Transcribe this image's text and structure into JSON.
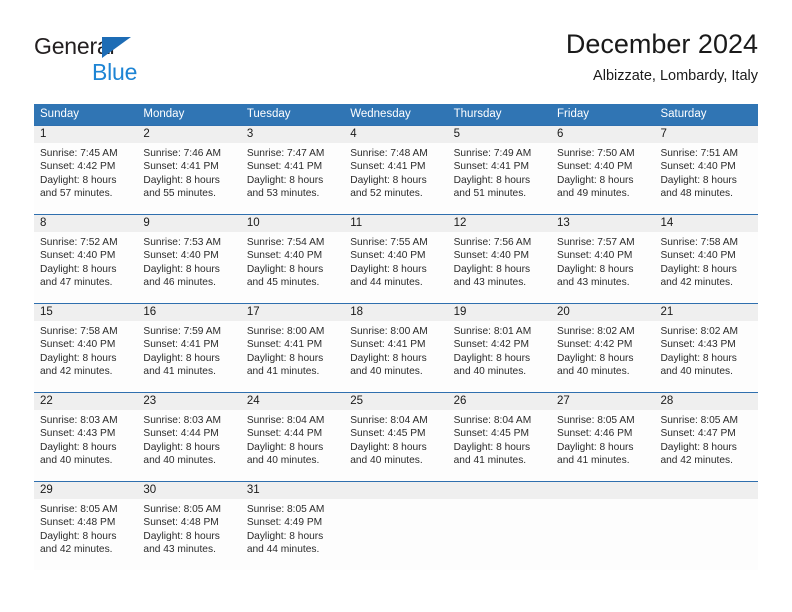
{
  "brand": {
    "name_dark": "General",
    "name_blue": "Blue",
    "accent_blue": "#1d84d4",
    "triangle_blue": "#1d6cb5"
  },
  "header": {
    "month_title": "December 2024",
    "location": "Albizzate, Lombardy, Italy"
  },
  "calendar": {
    "header_bg": "#3075b4",
    "numbar_bg": "#efefef",
    "weekday_headers": [
      "Sunday",
      "Monday",
      "Tuesday",
      "Wednesday",
      "Thursday",
      "Friday",
      "Saturday"
    ],
    "weeks": [
      [
        {
          "day": "1",
          "sunrise": "Sunrise: 7:45 AM",
          "sunset": "Sunset: 4:42 PM",
          "daylight1": "Daylight: 8 hours",
          "daylight2": "and 57 minutes."
        },
        {
          "day": "2",
          "sunrise": "Sunrise: 7:46 AM",
          "sunset": "Sunset: 4:41 PM",
          "daylight1": "Daylight: 8 hours",
          "daylight2": "and 55 minutes."
        },
        {
          "day": "3",
          "sunrise": "Sunrise: 7:47 AM",
          "sunset": "Sunset: 4:41 PM",
          "daylight1": "Daylight: 8 hours",
          "daylight2": "and 53 minutes."
        },
        {
          "day": "4",
          "sunrise": "Sunrise: 7:48 AM",
          "sunset": "Sunset: 4:41 PM",
          "daylight1": "Daylight: 8 hours",
          "daylight2": "and 52 minutes."
        },
        {
          "day": "5",
          "sunrise": "Sunrise: 7:49 AM",
          "sunset": "Sunset: 4:41 PM",
          "daylight1": "Daylight: 8 hours",
          "daylight2": "and 51 minutes."
        },
        {
          "day": "6",
          "sunrise": "Sunrise: 7:50 AM",
          "sunset": "Sunset: 4:40 PM",
          "daylight1": "Daylight: 8 hours",
          "daylight2": "and 49 minutes."
        },
        {
          "day": "7",
          "sunrise": "Sunrise: 7:51 AM",
          "sunset": "Sunset: 4:40 PM",
          "daylight1": "Daylight: 8 hours",
          "daylight2": "and 48 minutes."
        }
      ],
      [
        {
          "day": "8",
          "sunrise": "Sunrise: 7:52 AM",
          "sunset": "Sunset: 4:40 PM",
          "daylight1": "Daylight: 8 hours",
          "daylight2": "and 47 minutes."
        },
        {
          "day": "9",
          "sunrise": "Sunrise: 7:53 AM",
          "sunset": "Sunset: 4:40 PM",
          "daylight1": "Daylight: 8 hours",
          "daylight2": "and 46 minutes."
        },
        {
          "day": "10",
          "sunrise": "Sunrise: 7:54 AM",
          "sunset": "Sunset: 4:40 PM",
          "daylight1": "Daylight: 8 hours",
          "daylight2": "and 45 minutes."
        },
        {
          "day": "11",
          "sunrise": "Sunrise: 7:55 AM",
          "sunset": "Sunset: 4:40 PM",
          "daylight1": "Daylight: 8 hours",
          "daylight2": "and 44 minutes."
        },
        {
          "day": "12",
          "sunrise": "Sunrise: 7:56 AM",
          "sunset": "Sunset: 4:40 PM",
          "daylight1": "Daylight: 8 hours",
          "daylight2": "and 43 minutes."
        },
        {
          "day": "13",
          "sunrise": "Sunrise: 7:57 AM",
          "sunset": "Sunset: 4:40 PM",
          "daylight1": "Daylight: 8 hours",
          "daylight2": "and 43 minutes."
        },
        {
          "day": "14",
          "sunrise": "Sunrise: 7:58 AM",
          "sunset": "Sunset: 4:40 PM",
          "daylight1": "Daylight: 8 hours",
          "daylight2": "and 42 minutes."
        }
      ],
      [
        {
          "day": "15",
          "sunrise": "Sunrise: 7:58 AM",
          "sunset": "Sunset: 4:40 PM",
          "daylight1": "Daylight: 8 hours",
          "daylight2": "and 42 minutes."
        },
        {
          "day": "16",
          "sunrise": "Sunrise: 7:59 AM",
          "sunset": "Sunset: 4:41 PM",
          "daylight1": "Daylight: 8 hours",
          "daylight2": "and 41 minutes."
        },
        {
          "day": "17",
          "sunrise": "Sunrise: 8:00 AM",
          "sunset": "Sunset: 4:41 PM",
          "daylight1": "Daylight: 8 hours",
          "daylight2": "and 41 minutes."
        },
        {
          "day": "18",
          "sunrise": "Sunrise: 8:00 AM",
          "sunset": "Sunset: 4:41 PM",
          "daylight1": "Daylight: 8 hours",
          "daylight2": "and 40 minutes."
        },
        {
          "day": "19",
          "sunrise": "Sunrise: 8:01 AM",
          "sunset": "Sunset: 4:42 PM",
          "daylight1": "Daylight: 8 hours",
          "daylight2": "and 40 minutes."
        },
        {
          "day": "20",
          "sunrise": "Sunrise: 8:02 AM",
          "sunset": "Sunset: 4:42 PM",
          "daylight1": "Daylight: 8 hours",
          "daylight2": "and 40 minutes."
        },
        {
          "day": "21",
          "sunrise": "Sunrise: 8:02 AM",
          "sunset": "Sunset: 4:43 PM",
          "daylight1": "Daylight: 8 hours",
          "daylight2": "and 40 minutes."
        }
      ],
      [
        {
          "day": "22",
          "sunrise": "Sunrise: 8:03 AM",
          "sunset": "Sunset: 4:43 PM",
          "daylight1": "Daylight: 8 hours",
          "daylight2": "and 40 minutes."
        },
        {
          "day": "23",
          "sunrise": "Sunrise: 8:03 AM",
          "sunset": "Sunset: 4:44 PM",
          "daylight1": "Daylight: 8 hours",
          "daylight2": "and 40 minutes."
        },
        {
          "day": "24",
          "sunrise": "Sunrise: 8:04 AM",
          "sunset": "Sunset: 4:44 PM",
          "daylight1": "Daylight: 8 hours",
          "daylight2": "and 40 minutes."
        },
        {
          "day": "25",
          "sunrise": "Sunrise: 8:04 AM",
          "sunset": "Sunset: 4:45 PM",
          "daylight1": "Daylight: 8 hours",
          "daylight2": "and 40 minutes."
        },
        {
          "day": "26",
          "sunrise": "Sunrise: 8:04 AM",
          "sunset": "Sunset: 4:45 PM",
          "daylight1": "Daylight: 8 hours",
          "daylight2": "and 41 minutes."
        },
        {
          "day": "27",
          "sunrise": "Sunrise: 8:05 AM",
          "sunset": "Sunset: 4:46 PM",
          "daylight1": "Daylight: 8 hours",
          "daylight2": "and 41 minutes."
        },
        {
          "day": "28",
          "sunrise": "Sunrise: 8:05 AM",
          "sunset": "Sunset: 4:47 PM",
          "daylight1": "Daylight: 8 hours",
          "daylight2": "and 42 minutes."
        }
      ],
      [
        {
          "day": "29",
          "sunrise": "Sunrise: 8:05 AM",
          "sunset": "Sunset: 4:48 PM",
          "daylight1": "Daylight: 8 hours",
          "daylight2": "and 42 minutes."
        },
        {
          "day": "30",
          "sunrise": "Sunrise: 8:05 AM",
          "sunset": "Sunset: 4:48 PM",
          "daylight1": "Daylight: 8 hours",
          "daylight2": "and 43 minutes."
        },
        {
          "day": "31",
          "sunrise": "Sunrise: 8:05 AM",
          "sunset": "Sunset: 4:49 PM",
          "daylight1": "Daylight: 8 hours",
          "daylight2": "and 44 minutes."
        },
        {
          "day": "",
          "sunrise": "",
          "sunset": "",
          "daylight1": "",
          "daylight2": ""
        },
        {
          "day": "",
          "sunrise": "",
          "sunset": "",
          "daylight1": "",
          "daylight2": ""
        },
        {
          "day": "",
          "sunrise": "",
          "sunset": "",
          "daylight1": "",
          "daylight2": ""
        },
        {
          "day": "",
          "sunrise": "",
          "sunset": "",
          "daylight1": "",
          "daylight2": ""
        }
      ]
    ]
  }
}
